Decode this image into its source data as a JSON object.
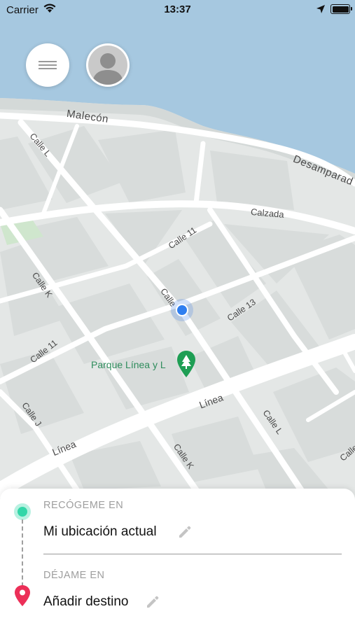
{
  "status_bar": {
    "carrier": "Carrier",
    "time": "13:37",
    "battery_level": 0.9
  },
  "map": {
    "streets": {
      "malecon": "Malecón",
      "desamparados": "Desamparad",
      "calzada": "Calzada",
      "calle_11_top": "Calle 11",
      "calle_l_top": "Calle L",
      "calle_k_left": "Calle K",
      "calle_13": "Calle 13",
      "calle_11_left": "Calle 11",
      "calle_l_center": "Calle",
      "calle_j": "Calle J",
      "linea_center": "Línea",
      "linea_left": "Línea",
      "calle_l_bottom": "Calle L",
      "calle_k_bottom": "Calle K",
      "calle_edge": "Calle"
    },
    "park": "Parque Línea y L",
    "colors": {
      "water": "#a6c8e0",
      "land": "#e4e7e6",
      "road": "#ffffff",
      "block": "#d9dddc",
      "pin": "#2f7ef0",
      "park_pin": "#1e9e54"
    }
  },
  "sheet": {
    "pickup_label": "RECÓGEME EN",
    "pickup_value": "Mi ubicación actual",
    "dropoff_label": "DÉJAME EN",
    "dropoff_value": "Añadir destino",
    "colors": {
      "pickup_dot": "#33d6a8",
      "dropoff_pin": "#ec2f58"
    }
  }
}
